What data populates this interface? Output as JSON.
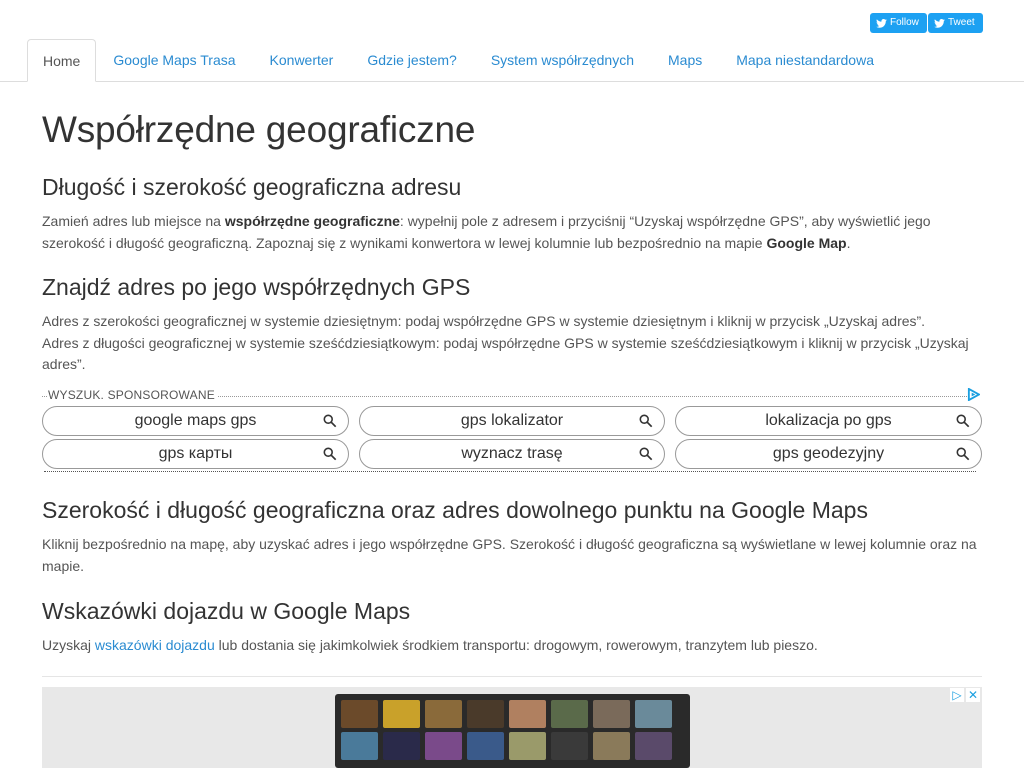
{
  "social": {
    "follow_label": "Follow",
    "tweet_label": "Tweet"
  },
  "nav": {
    "tabs": [
      {
        "label": "Home",
        "active": true
      },
      {
        "label": "Google Maps Trasa"
      },
      {
        "label": "Konwerter"
      },
      {
        "label": "Gdzie jestem?"
      },
      {
        "label": "System współrzędnych"
      },
      {
        "label": "Maps"
      },
      {
        "label": "Mapa niestandardowa"
      }
    ]
  },
  "page": {
    "title": "Współrzędne geograficzne",
    "section1": {
      "heading": "Długość i szerokość geograficzna adresu",
      "text_a": "Zamień adres lub miejsce na ",
      "bold_a": "współrzędne geograficzne",
      "text_b": ": wypełnij pole z adresem i przyciśnij “Uzyskaj współrzędne GPS”, aby wyświetlić jego szerokość i długość geograficzną. Zapoznaj się z wynikami konwertora w lewej kolumnie lub bezpośrednio na mapie ",
      "bold_b": "Google Map",
      "text_c": "."
    },
    "section2": {
      "heading": "Znajdź adres po jego współrzędnych GPS",
      "line1": "Adres z szerokości geograficznej w systemie dziesiętnym: podaj współrzędne GPS w systemie dziesiętnym i kliknij w przycisk „Uzyskaj adres”.",
      "line2": "Adres z długości geograficznej w systemie sześćdziesiątkowym: podaj współrzędne GPS w systemie sześćdziesiątkowym i kliknij w przycisk „Uzyskaj adres”."
    },
    "sponsored": {
      "label": "WYSZUK. SPONSOROWANE",
      "keywords": [
        "google maps gps",
        "gps lokalizator",
        "lokalizacja po gps",
        "gps карты",
        "wyznacz trasę",
        "gps geodezyjny"
      ]
    },
    "section3": {
      "heading": "Szerokość i długość geograficzna oraz adres dowolnego punktu na Google Maps",
      "text": "Kliknij bezpośrednio na mapę, aby uzyskać adres i jego współrzędne GPS. Szerokość i długość geograficzna są wyświetlane w lewej kolumnie oraz na mapie."
    },
    "section4": {
      "heading": "Wskazówki dojazdu w Google Maps",
      "text_a": "Uzyskaj ",
      "link": "wskazówki dojazdu",
      "text_b": " lub dostania się jakimkolwiek środkiem transportu: drogowym, rowerowym, tranzytem lub pieszo."
    }
  },
  "ad": {
    "close_label": "✕"
  },
  "colors": {
    "link": "#2a8bd1",
    "twitter": "#1da1f2",
    "adchoices": "#1a9fe0"
  }
}
